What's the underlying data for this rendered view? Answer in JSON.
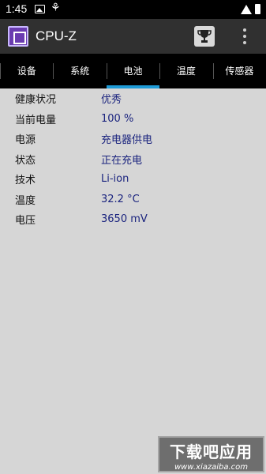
{
  "status_bar": {
    "time": "1:45",
    "icons": [
      "image-icon",
      "notification-icon",
      "wifi-icon",
      "battery-icon"
    ]
  },
  "app_bar": {
    "title": "CPU-Z",
    "logo": "cpu-chip-icon",
    "actions": [
      "trophy-icon",
      "overflow-menu-icon"
    ]
  },
  "tabs": [
    {
      "label": "设备",
      "active": false
    },
    {
      "label": "系统",
      "active": false
    },
    {
      "label": "电池",
      "active": true
    },
    {
      "label": "温度",
      "active": false
    },
    {
      "label": "传感器",
      "active": false
    }
  ],
  "battery_info": [
    {
      "key": "健康状况",
      "value": "优秀"
    },
    {
      "key": "当前电量",
      "value": "100 %"
    },
    {
      "key": "电源",
      "value": "充电器供电"
    },
    {
      "key": "状态",
      "value": "正在充电"
    },
    {
      "key": "技术",
      "value": "Li-ion"
    },
    {
      "key": "温度",
      "value": "32.2 °C"
    },
    {
      "key": "电压",
      "value": "3650 mV"
    }
  ],
  "watermark": {
    "title": "下载吧应用",
    "url": "www.xiazaiba.com"
  },
  "colors": {
    "tab_indicator": "#1e9bd7",
    "value_text": "#1a237e",
    "app_bar": "#303030",
    "background": "#d6d6d6"
  }
}
